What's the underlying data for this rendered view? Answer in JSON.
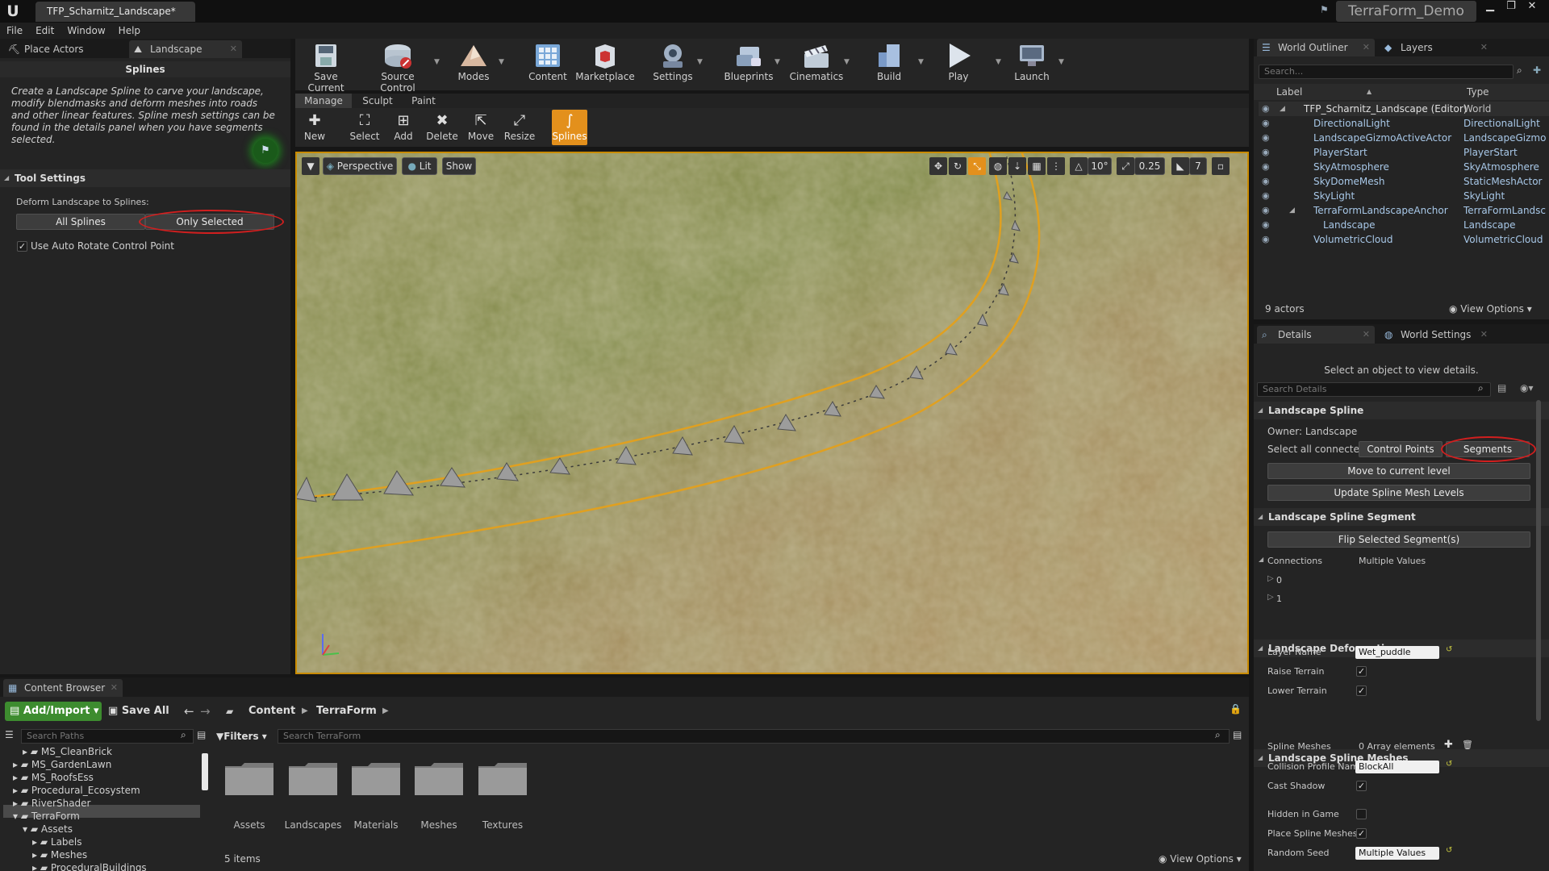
{
  "window": {
    "doc_tab": "TFP_Scharnitz_Landscape*",
    "project_name": "TerraForm_Demo"
  },
  "menu": [
    "File",
    "Edit",
    "Window",
    "Help"
  ],
  "left_panel": {
    "tabs": [
      "Place Actors",
      "Landscape"
    ],
    "splines_title": "Splines",
    "description": "Create a Landscape Spline to carve your landscape, modify blendmasks and deform meshes into roads and other linear features.  Spline mesh settings can be found in the details panel when you have segments selected.",
    "tool_settings_header": "Tool Settings",
    "deform_label": "Deform Landscape to Splines:",
    "all_splines": "All Splines",
    "only_selected": "Only Selected",
    "auto_rotate": "Use Auto Rotate Control Point"
  },
  "toolbar": [
    "Save Current",
    "Source Control",
    "Modes",
    "Content",
    "Marketplace",
    "Settings",
    "Blueprints",
    "Cinematics",
    "Build",
    "Play",
    "Launch"
  ],
  "mode_tabs": [
    "Manage",
    "Sculpt",
    "Paint"
  ],
  "subtools": [
    "New",
    "Select",
    "Add",
    "Delete",
    "Move",
    "Resize",
    "Splines"
  ],
  "viewport": {
    "perspective": "Perspective",
    "lit": "Lit",
    "show": "Show",
    "rotation_snap": "10°",
    "scale_snap": "0.25",
    "camera_speed": "7"
  },
  "outliner": {
    "tabs": [
      "World Outliner",
      "Layers"
    ],
    "search_placeholder": "Search...",
    "col_label": "Label",
    "col_type": "Type",
    "rows": [
      {
        "label": "TFP_Scharnitz_Landscape (Editor)",
        "type": "World"
      },
      {
        "label": "DirectionalLight",
        "type": "DirectionalLight"
      },
      {
        "label": "LandscapeGizmoActiveActor",
        "type": "LandscapeGizmo"
      },
      {
        "label": "PlayerStart",
        "type": "PlayerStart"
      },
      {
        "label": "SkyAtmosphere",
        "type": "SkyAtmosphere"
      },
      {
        "label": "SkyDomeMesh",
        "type": "StaticMeshActor"
      },
      {
        "label": "SkyLight",
        "type": "SkyLight"
      },
      {
        "label": "TerraFormLandscapeAnchor",
        "type": "TerraFormLandsc"
      },
      {
        "label": "Landscape",
        "type": "Landscape"
      },
      {
        "label": "VolumetricCloud",
        "type": "VolumetricCloud"
      }
    ],
    "actor_count": "9 actors",
    "view_options": "View Options"
  },
  "details": {
    "tabs": [
      "Details",
      "World Settings"
    ],
    "hint": "Select an object to view details.",
    "search_placeholder": "Search Details",
    "landscape_spline": "Landscape Spline",
    "owner": "Owner: Landscape",
    "select_all_connected": "Select all connected:",
    "control_points": "Control Points",
    "segments": "Segments",
    "move_to_level": "Move to current level",
    "update_mesh_levels": "Update Spline Mesh Levels",
    "segment_header": "Landscape Spline Segment",
    "flip_segments": "Flip Selected Segment(s)",
    "connections": "Connections",
    "connections_value": "Multiple Values",
    "conn_0": "0",
    "conn_1": "1",
    "deformation_header": "Landscape Deformation",
    "layer_name": "Layer Name",
    "layer_name_value": "Wet_puddle",
    "raise_terrain": "Raise Terrain",
    "lower_terrain": "Lower Terrain",
    "meshes_header": "Landscape Spline Meshes",
    "spline_meshes": "Spline Meshes",
    "spline_meshes_value": "0 Array elements",
    "collision_profile": "Collision Profile Nam",
    "collision_value": "BlockAll",
    "cast_shadow": "Cast Shadow",
    "hidden_in_game": "Hidden in Game",
    "place_spline_meshes": "Place Spline Meshes",
    "random_seed": "Random Seed",
    "random_seed_value": "Multiple Values"
  },
  "content_browser": {
    "tab": "Content Browser",
    "add_import": "Add/Import",
    "save_all": "Save All",
    "path": [
      "Content",
      "TerraForm"
    ],
    "search_paths_placeholder": "Search Paths",
    "filters": "Filters",
    "search_placeholder": "Search TerraForm",
    "tree": [
      "MS_CleanBrick",
      "MS_GardenLawn",
      "MS_RoofsEss",
      "Procedural_Ecosystem",
      "RiverShader",
      "TerraForm",
      "Assets",
      "Labels",
      "Meshes",
      "ProceduralBuildings"
    ],
    "folders": [
      "Assets",
      "Landscapes",
      "Materials",
      "Meshes",
      "Textures"
    ],
    "item_count": "5 items",
    "view_options": "View Options"
  }
}
